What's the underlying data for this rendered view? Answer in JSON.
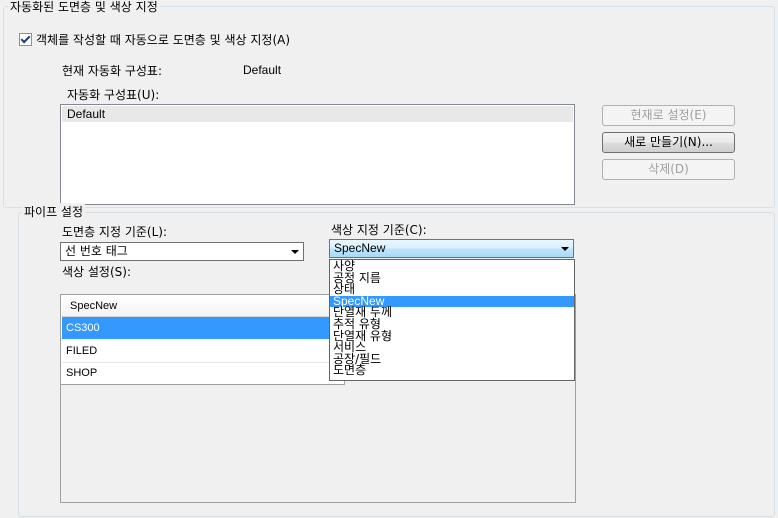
{
  "auto_layer": {
    "group_title": "자동화된 도면층 및 색상 지정",
    "checkbox_label": "객체를 작성할 때 자동으로 도면층 및 색상 지정(A)",
    "checked": true,
    "current_label": "현재 자동화 구성표:",
    "current_value": "Default",
    "schemes_label": "자동화 구성표(U):",
    "schemes": [
      "Default"
    ],
    "set_current_button": "현재로 설정(E)",
    "new_button": "새로 만들기(N)...",
    "delete_button": "삭제(D)"
  },
  "pipe": {
    "group_title": "파이프 설정",
    "layer_label": "도면층 지정 기준(L):",
    "layer_value": "선 번호 태그",
    "color_label": "색상 지정 기준(C):",
    "color_value": "SpecNew",
    "color_settings_label": "색상 설정(S):",
    "color_settings_header": "SpecNew",
    "color_rows": [
      "CS300",
      "FILED",
      "SHOP"
    ],
    "dropdown_options": [
      "사양",
      "공정 지름",
      "상태",
      "SpecNew",
      "단열재 두께",
      "추적 유형",
      "단열재 유형",
      "서비스",
      "공장/필드",
      "도면층"
    ],
    "dropdown_selected_index": 3
  },
  "colors": {
    "selection": "#3399ff",
    "groupbox_border": "#d5dfe5"
  }
}
